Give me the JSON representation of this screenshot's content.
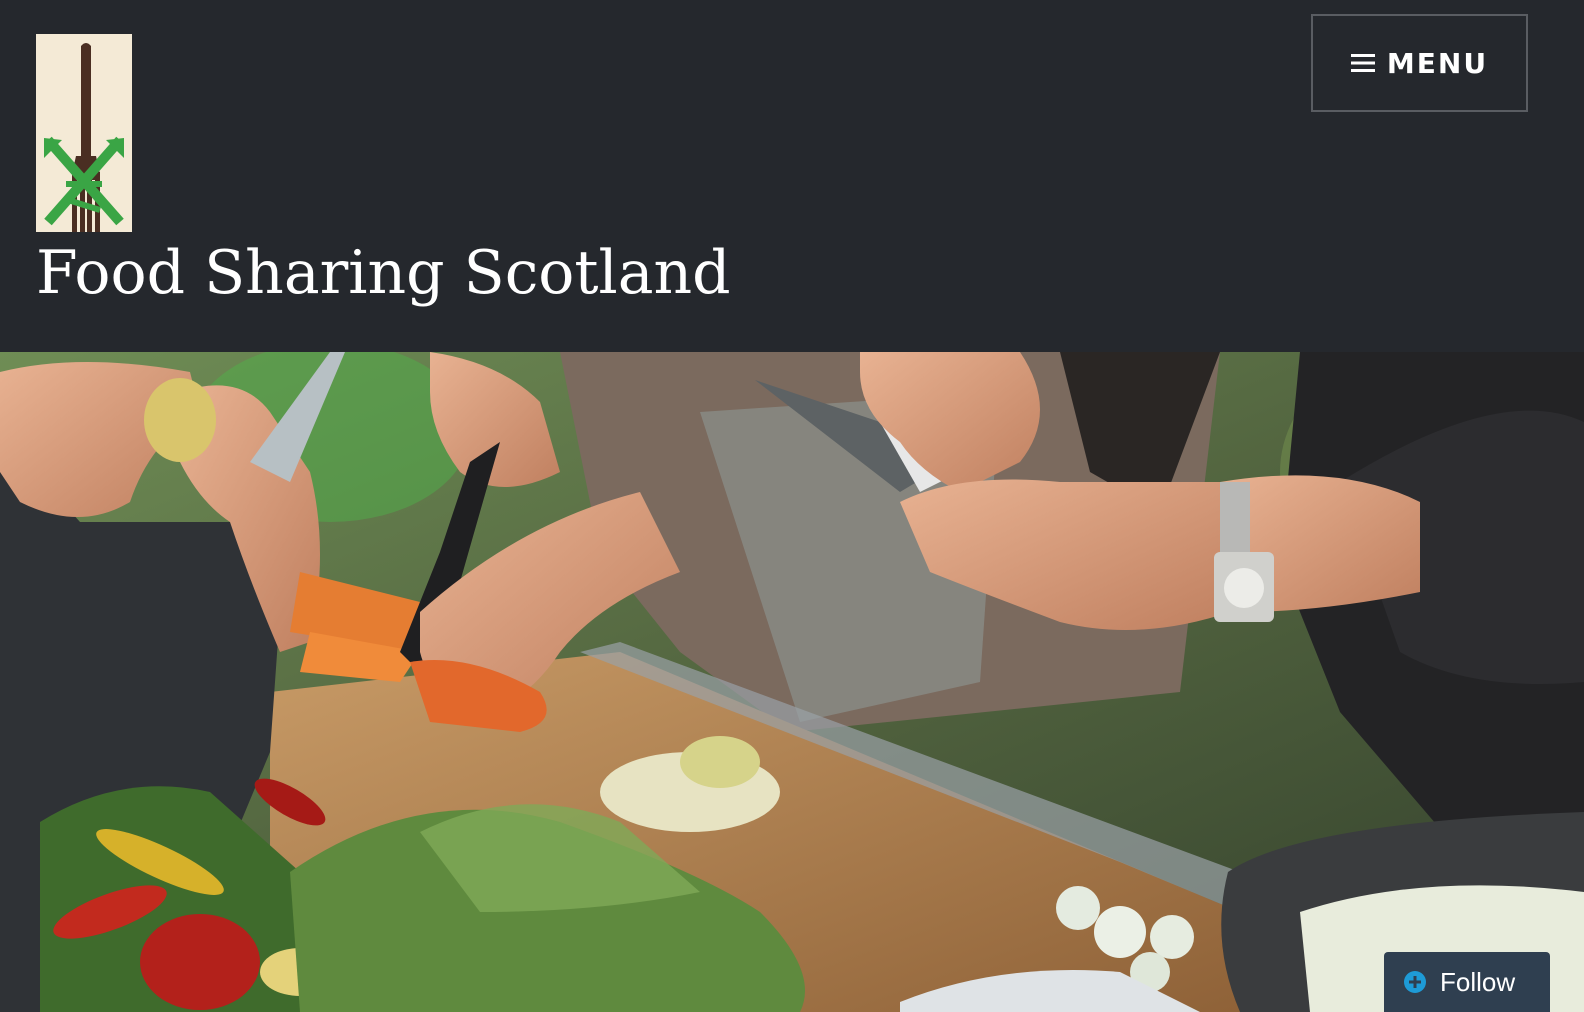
{
  "site": {
    "title": "Food Sharing Scotland"
  },
  "header": {
    "menu_label": "MENU",
    "menu_icon": "hamburger-icon",
    "logo_icon": "fork-logo-icon"
  },
  "hero": {
    "image": "people-cutting-vegetables-photo"
  },
  "follow": {
    "label": "Follow",
    "icon": "plus-circle-icon"
  },
  "colors": {
    "header_bg": "#25282d",
    "logo_bg": "#f4ead6",
    "logo_accent": "#3aa545",
    "follow_bg": "#2f3f50",
    "follow_icon": "#1e9bd7"
  }
}
